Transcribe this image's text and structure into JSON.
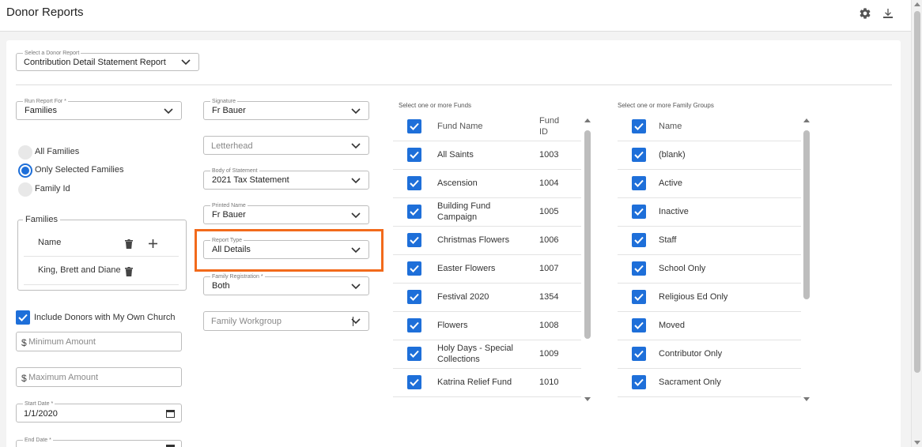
{
  "header": {
    "title": "Donor Reports",
    "settings_icon": "gear-icon",
    "download_icon": "download-icon"
  },
  "report_select": {
    "label": "Select a Donor Report",
    "value": "Contribution Detail Statement Report"
  },
  "left": {
    "run_report_for": {
      "label": "Run Report For *",
      "value": "Families"
    },
    "radios": [
      {
        "label": "All Families",
        "selected": false
      },
      {
        "label": "Only Selected Families",
        "selected": true
      },
      {
        "label": "Family Id",
        "selected": false
      }
    ],
    "families": {
      "legend": "Families",
      "header_name": "Name",
      "rows": [
        "King, Brett and Diane"
      ]
    },
    "include_donors": {
      "label": "Include Donors with My Own Church",
      "checked": true
    },
    "minimum_amount": {
      "placeholder": "Minimum Amount",
      "currency": "$"
    },
    "maximum_amount": {
      "placeholder": "Maximum Amount",
      "currency": "$"
    },
    "start_date": {
      "label": "Start Date *",
      "value": "1/1/2020"
    },
    "end_date": {
      "label": "End Date *"
    }
  },
  "middle": {
    "signature": {
      "label": "Signature",
      "value": "Fr Bauer"
    },
    "letterhead": {
      "placeholder": "Letterhead"
    },
    "body_of_statement": {
      "label": "Body of Statement",
      "value": "2021 Tax Statement"
    },
    "printed_name": {
      "label": "Printed Name",
      "value": "Fr Bauer"
    },
    "report_type": {
      "label": "Report Type",
      "value": "All Details"
    },
    "family_registration": {
      "label": "Family Registration *",
      "value": "Both"
    },
    "family_workgroup": {
      "placeholder": "Family Workgroup"
    }
  },
  "funds": {
    "caption": "Select one or more Funds",
    "col_name": "Fund Name",
    "col_id": "Fund ID",
    "rows": [
      {
        "name": "All Saints",
        "id": "1003"
      },
      {
        "name": "Ascension",
        "id": "1004"
      },
      {
        "name": "Building Fund Campaign",
        "id": "1005"
      },
      {
        "name": "Christmas Flowers",
        "id": "1006"
      },
      {
        "name": "Easter Flowers",
        "id": "1007"
      },
      {
        "name": "Festival 2020",
        "id": "1354"
      },
      {
        "name": "Flowers",
        "id": "1008"
      },
      {
        "name": "Holy Days - Special Collections",
        "id": "1009"
      },
      {
        "name": "Katrina Relief Fund",
        "id": "1010"
      }
    ]
  },
  "groups": {
    "caption": "Select one or more Family Groups",
    "col_name": "Name",
    "rows": [
      "(blank)",
      "Active",
      "Inactive",
      "Staff",
      "School Only",
      "Religious Ed Only",
      "Moved",
      "Contributor Only",
      "Sacrament Only"
    ]
  }
}
